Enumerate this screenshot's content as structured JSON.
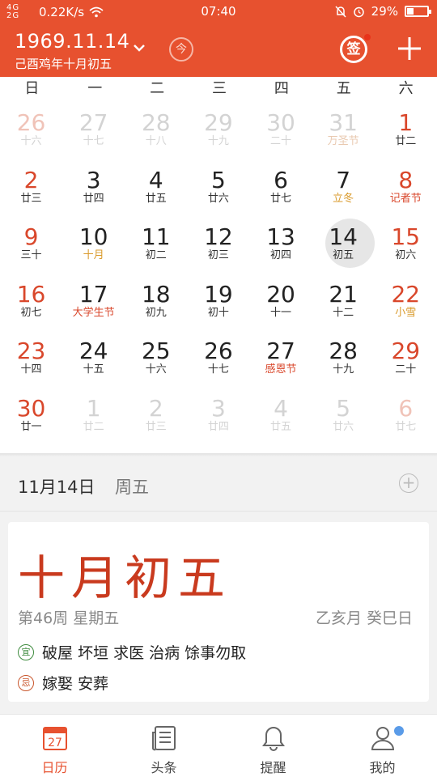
{
  "status_bar": {
    "signal": "4G 2G",
    "speed": "0.22K/s",
    "time": "07:40",
    "battery": "29%"
  },
  "header": {
    "date": "1969.11.14",
    "lunar": "己酉鸡年十月初五",
    "today_button": "今",
    "sign_button": "签"
  },
  "weekdays": [
    "日",
    "一",
    "二",
    "三",
    "四",
    "五",
    "六"
  ],
  "calendar": [
    {
      "day": "26",
      "sub": "十六",
      "dim": true,
      "red": true
    },
    {
      "day": "27",
      "sub": "十七",
      "dim": true
    },
    {
      "day": "28",
      "sub": "十八",
      "dim": true
    },
    {
      "day": "29",
      "sub": "十九",
      "dim": true
    },
    {
      "day": "30",
      "sub": "二十",
      "dim": true
    },
    {
      "day": "31",
      "sub": "万圣节",
      "dim": true,
      "subtype": "hol"
    },
    {
      "day": "1",
      "sub": "廿二",
      "red": true
    },
    {
      "day": "2",
      "sub": "廿三",
      "red": true
    },
    {
      "day": "3",
      "sub": "廿四"
    },
    {
      "day": "4",
      "sub": "廿五"
    },
    {
      "day": "5",
      "sub": "廿六"
    },
    {
      "day": "6",
      "sub": "廿七"
    },
    {
      "day": "7",
      "sub": "立冬",
      "subtype": "term"
    },
    {
      "day": "8",
      "sub": "记者节",
      "red": true,
      "subtype": "hol"
    },
    {
      "day": "9",
      "sub": "三十",
      "red": true
    },
    {
      "day": "10",
      "sub": "十月",
      "subtype": "term"
    },
    {
      "day": "11",
      "sub": "初二"
    },
    {
      "day": "12",
      "sub": "初三"
    },
    {
      "day": "13",
      "sub": "初四"
    },
    {
      "day": "14",
      "sub": "初五",
      "selected": true
    },
    {
      "day": "15",
      "sub": "初六",
      "red": true
    },
    {
      "day": "16",
      "sub": "初七",
      "red": true
    },
    {
      "day": "17",
      "sub": "大学生节",
      "subtype": "hol"
    },
    {
      "day": "18",
      "sub": "初九"
    },
    {
      "day": "19",
      "sub": "初十"
    },
    {
      "day": "20",
      "sub": "十一"
    },
    {
      "day": "21",
      "sub": "十二"
    },
    {
      "day": "22",
      "sub": "小雪",
      "red": true,
      "subtype": "term"
    },
    {
      "day": "23",
      "sub": "十四",
      "red": true
    },
    {
      "day": "24",
      "sub": "十五"
    },
    {
      "day": "25",
      "sub": "十六"
    },
    {
      "day": "26",
      "sub": "十七"
    },
    {
      "day": "27",
      "sub": "感恩节",
      "subtype": "hol"
    },
    {
      "day": "28",
      "sub": "十九"
    },
    {
      "day": "29",
      "sub": "二十",
      "red": true
    },
    {
      "day": "30",
      "sub": "廿一",
      "red": true
    },
    {
      "day": "1",
      "sub": "廿二",
      "dim": true
    },
    {
      "day": "2",
      "sub": "廿三",
      "dim": true
    },
    {
      "day": "3",
      "sub": "廿四",
      "dim": true
    },
    {
      "day": "4",
      "sub": "廿五",
      "dim": true
    },
    {
      "day": "5",
      "sub": "廿六",
      "dim": true
    },
    {
      "day": "6",
      "sub": "廿七",
      "dim": true,
      "red": true
    }
  ],
  "selected": {
    "date": "11月14日",
    "weekday": "周五"
  },
  "almanac": {
    "lunar_big": "十月初五",
    "week_info": "第46周  星期五",
    "ganzhi": "乙亥月  癸巳日",
    "yi_label": "宜",
    "yi": "破屋 坏垣 求医 治病 馀事勿取",
    "ji_label": "忌",
    "ji": "嫁娶 安葬"
  },
  "nav": [
    {
      "label": "日历",
      "icon": "calendar-icon",
      "active": true,
      "icon_text": "27"
    },
    {
      "label": "头条",
      "icon": "news-icon"
    },
    {
      "label": "提醒",
      "icon": "bell-icon"
    },
    {
      "label": "我的",
      "icon": "profile-icon",
      "badge": true
    }
  ],
  "colors": {
    "accent": "#e7512f",
    "holiday": "#d9472b",
    "term": "#d99a2b"
  }
}
